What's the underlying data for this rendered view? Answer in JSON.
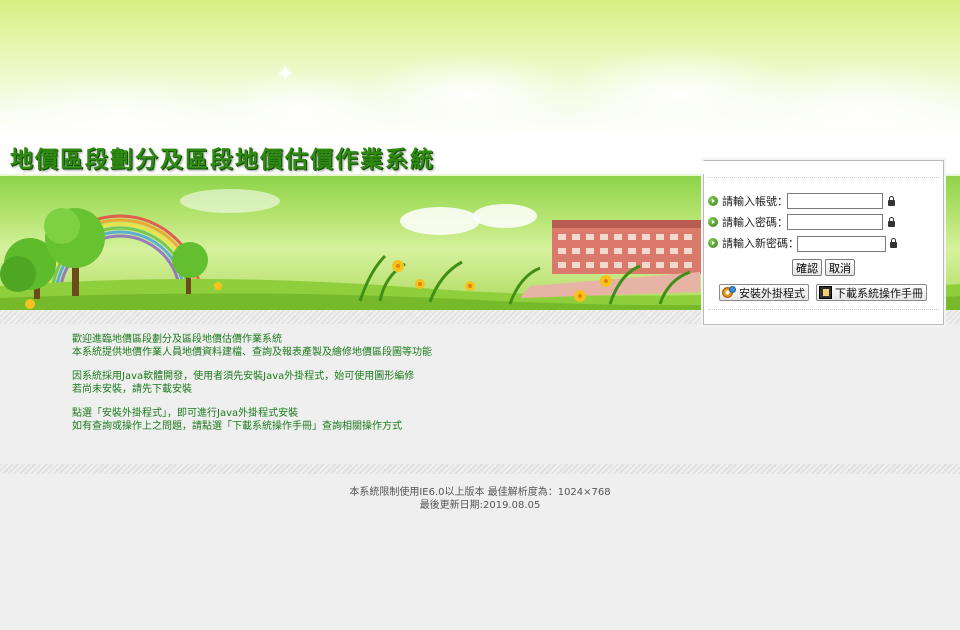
{
  "header": {
    "title": "地價區段劃分及區段地價估價作業系統"
  },
  "login": {
    "account_label": "請輸入帳號：",
    "account_value": "",
    "password_label": "請輸入密碼：",
    "password_value": "",
    "new_password_label": "請輸入新密碼：",
    "new_password_value": "",
    "confirm_label": "確認",
    "cancel_label": "取消",
    "install_plugin_label": "安裝外掛程式",
    "download_manual_label": "下載系統操作手冊"
  },
  "content": {
    "lines": [
      "歡迎進臨地價區段劃分及區段地價估價作業系統",
      "本系統提供地價作業人員地價資料建檔、查詢及報表產製及繪修地價區段圖等功能",
      "因系統採用Java軟體開發，使用者須先安裝Java外掛程式，始可使用圖形編修",
      "若尚未安裝，請先下載安裝",
      "點選「安裝外掛程式」，即可進行Java外掛程式安裝",
      "如有查詢或操作上之問題，請點選「下載系統操作手冊」查詢相關操作方式"
    ]
  },
  "footer": {
    "browser_note": "本系統限制使用IE6.0以上版本 最佳解析度為：1024×768",
    "last_updated": "最後更新日期:2019.08.05"
  },
  "colors": {
    "title_green": "#2f8a12",
    "content_green": "#1c7a1c",
    "footer_gray": "#555555"
  },
  "icons": [
    "lock-icon",
    "bullet-arrow-icon",
    "gear-plugin-icon",
    "manual-book-icon"
  ]
}
